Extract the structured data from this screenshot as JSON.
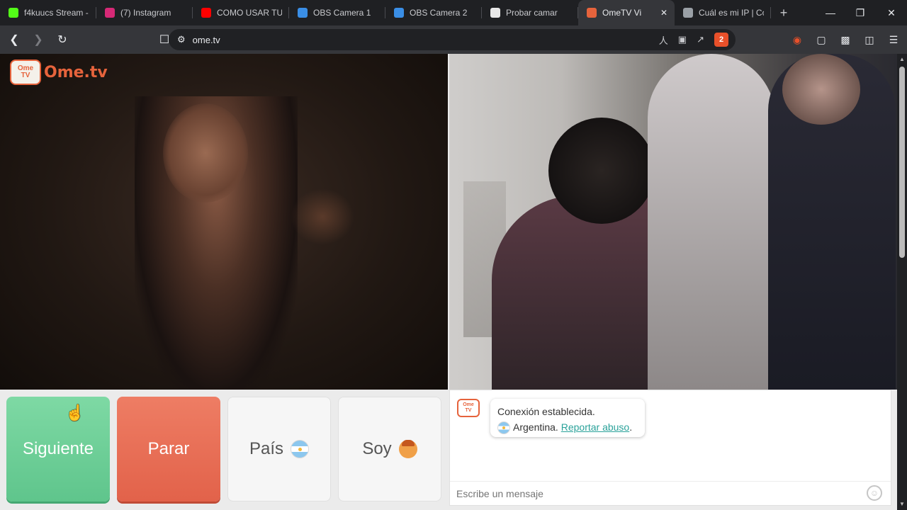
{
  "tabs": [
    {
      "title": "f4kuucs Stream - ",
      "favicon": "kick-icon",
      "color": "#53fc18"
    },
    {
      "title": "(7) Instagram",
      "favicon": "instagram-icon",
      "color": "#d62976"
    },
    {
      "title": "COMO USAR TU C",
      "favicon": "youtube-icon",
      "color": "#ff0000"
    },
    {
      "title": "OBS Camera 1",
      "favicon": "obs-icon",
      "color": "#3a8ee6"
    },
    {
      "title": "OBS Camera 2",
      "favicon": "obs-icon",
      "color": "#3a8ee6"
    },
    {
      "title": "Probar camar",
      "favicon": "camera-icon",
      "color": "#e8e8e8"
    },
    {
      "title": "OmeTV Vi",
      "favicon": "ometv-icon",
      "color": "#e6633c",
      "active": true
    },
    {
      "title": "Cuál es mi IP | Có",
      "favicon": "globe-icon",
      "color": "#9aa0a6"
    }
  ],
  "toolbar": {
    "url": "ome.tv",
    "brave_badge": "2"
  },
  "logo": {
    "tv_line1": "Ome",
    "tv_line2": "TV",
    "brand": "Ome.tv"
  },
  "controls": {
    "next_label": "Siguiente",
    "stop_label": "Parar",
    "country_label": "País",
    "gender_label": "Soy"
  },
  "chat": {
    "status": "Conexión establecida.",
    "country": "Argentina.",
    "report_link": "Reportar abuso",
    "report_suffix": ".",
    "input_placeholder": "Escribe un mensaje"
  }
}
